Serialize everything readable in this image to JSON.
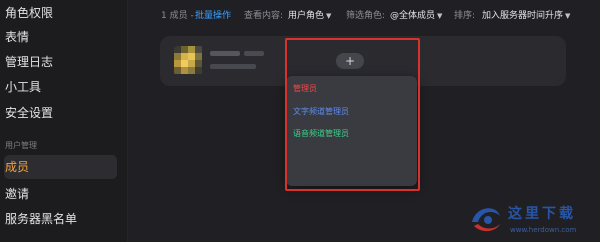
{
  "sidebar": {
    "items": [
      {
        "label": "角色权限"
      },
      {
        "label": "表情"
      },
      {
        "label": "管理日志"
      },
      {
        "label": "小工具"
      },
      {
        "label": "安全设置"
      }
    ],
    "section_label": "用户管理",
    "section_items": [
      {
        "label": "成员",
        "active": true
      },
      {
        "label": "邀请"
      },
      {
        "label": "服务器黑名单"
      }
    ]
  },
  "toolbar": {
    "member_count": "1 成员 -",
    "bulk_action": "批量操作",
    "view_label": "查看内容:",
    "view_value": "用户角色",
    "filter_label": "筛选角色:",
    "filter_value": "@全体成员",
    "sort_label": "排序:",
    "sort_value": "加入服务器时间升序"
  },
  "member_card": {
    "add_role_symbol": "+"
  },
  "role_dropdown": {
    "options": [
      {
        "label": "管理员",
        "color": "#f04a4a"
      },
      {
        "label": "文字频道管理员",
        "color": "#5d8cf0"
      },
      {
        "label": "语音频道管理员",
        "color": "#3ecf8e"
      }
    ]
  },
  "watermark": {
    "text": "这里下载",
    "url": "www.herdown.com"
  },
  "colors": {
    "accent_active": "#f4a537",
    "link": "#3aa0ff",
    "highlight": "#d8322c"
  }
}
